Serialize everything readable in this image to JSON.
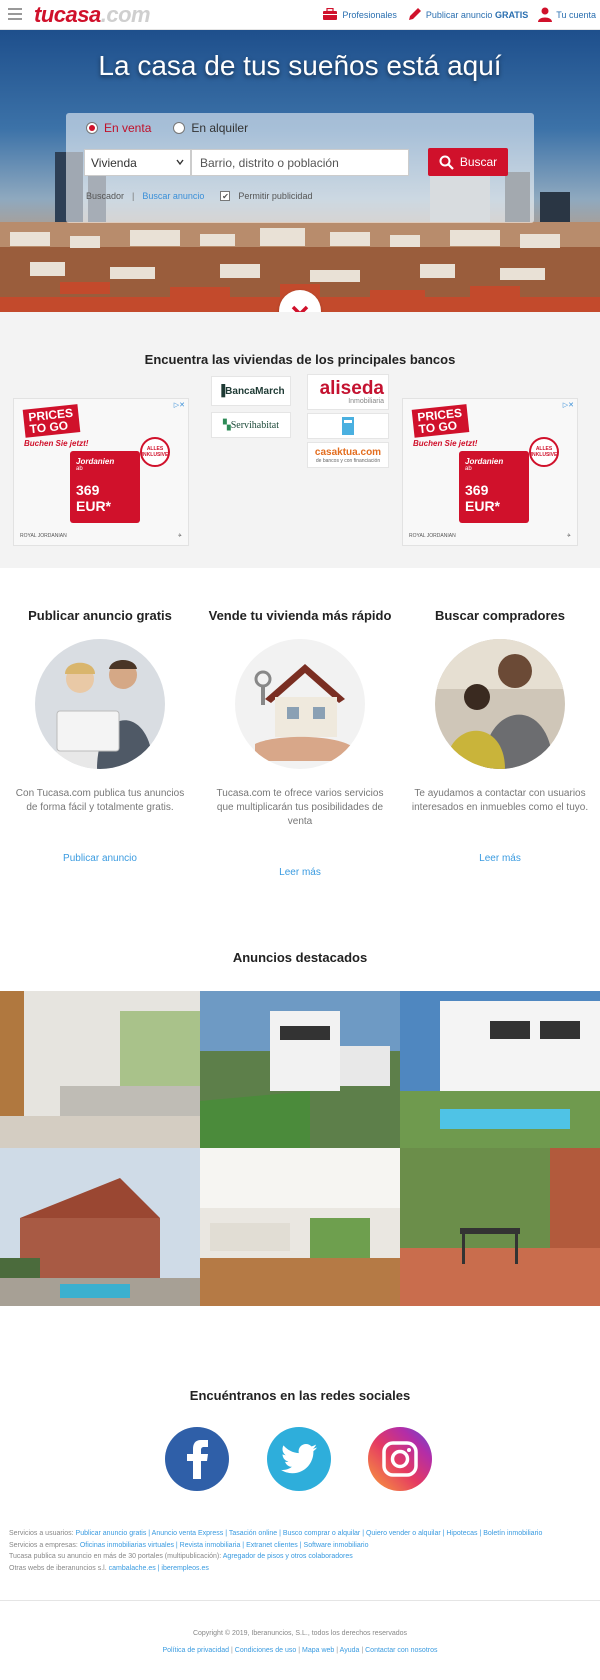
{
  "header": {
    "logo_a": "tucasa",
    "logo_b": ".com",
    "professionals": "Profesionales",
    "publish_prefix": "Publicar anuncio",
    "publish_bold": "GRATIS",
    "account": "Tu cuenta"
  },
  "hero": {
    "title": "La casa de tus sueños está aquí",
    "radio_sale": "En venta",
    "radio_rent": "En alquiler",
    "property_type": "Vivienda",
    "location_placeholder": "Barrio, distrito o población",
    "search_button": "Buscar",
    "link_search": "Buscador",
    "link_search_ad": "Buscar anuncio",
    "allow_ads": "Permitir publicidad"
  },
  "banks": {
    "title": "Encuentra las viviendas de los principales bancos",
    "ad_tag": "PUBLICIDAD",
    "ad_prices": "PRICES",
    "ad_togo": "TO GO",
    "ad_book": "Buchen Sie jetzt!",
    "ad_dest": "Jordanien",
    "ad_from": "ab",
    "ad_price": "369 EUR*",
    "ad_seal": "ALLES INKLUSIVE",
    "ad_brand": "ROYAL JORDANIAN",
    "logos": {
      "bancamarch": "BancaMarch",
      "servihabitat": "Servihabitat",
      "aliseda": "aliseda",
      "aliseda_sub": "Inmobiliaria",
      "casaktua": "casaktua.com",
      "casaktua_sub": "de bancos y con financiación"
    }
  },
  "features": [
    {
      "title": "Publicar anuncio gratis",
      "text": "Con Tucasa.com publica tus anuncios de forma fácil y totalmente gratis.",
      "link": "Publicar anuncio"
    },
    {
      "title": "Vende tu vivienda más rápido",
      "text": "Tucasa.com te ofrece varios servicios que multiplicarán tus posibilidades de venta",
      "link": "Leer más"
    },
    {
      "title": "Buscar compradores",
      "text": "Te ayudamos a contactar con usuarios interesados en inmuebles como el tuyo.",
      "link": "Leer más"
    }
  ],
  "featured": {
    "title": "Anuncios destacados"
  },
  "social": {
    "title": "Encuéntranos en las redes sociales"
  },
  "footer": {
    "users_label": "Servicios a usuarios:",
    "users_links": "Publicar anuncio gratis | Anuncio venta Express | Tasación online | Busco comprar o alquilar | Quiero vender o alquilar | Hipotecas | Boletín inmobiliario",
    "business_label": "Servicios a empresas:",
    "business_links": "Oficinas inmobiliarias virtuales | Revista inmobiliaria | Extranet clientes | Software inmobiliario",
    "portals_text": "Tucasa publica su anuncio en más de 30 portales (multipublicación):",
    "portals_link": "Agregador de pisos y otros colaboradores",
    "other_label": "Otras webs de iberanuncios s.l.",
    "other_links": "cambalache.es | iberempleos.es",
    "copyright": "Copyright © 2019, Iberanuncios, S.L., todos los derechos reservados",
    "legal": [
      "Política de privacidad",
      "Condiciones de uso",
      "Mapa web",
      "Ayuda",
      "Contactar con nosotros"
    ]
  },
  "colors": {
    "brand_red": "#d0112b",
    "link_blue": "#3a9be0",
    "nav_blue": "#2a6fb0"
  }
}
